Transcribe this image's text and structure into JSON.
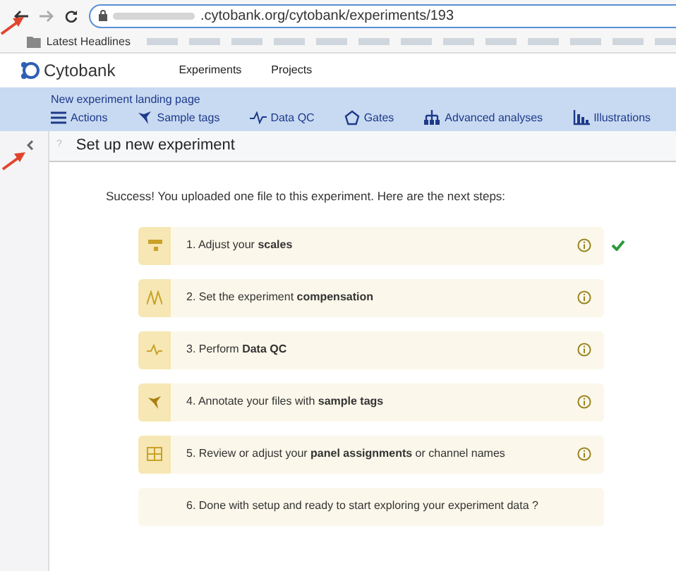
{
  "browser": {
    "url": ".cytobank.org/cytobank/experiments/193",
    "bookmarks_label": "Latest Headlines"
  },
  "header": {
    "brand": "Cytobank",
    "nav": [
      "Experiments",
      "Projects"
    ]
  },
  "toolbar": {
    "title": "New experiment landing page",
    "items": [
      {
        "label": "Actions",
        "kind": "menu"
      },
      {
        "label": "Sample tags",
        "kind": "tags"
      },
      {
        "label": "Data QC",
        "kind": "qc"
      },
      {
        "label": "Gates",
        "kind": "gates"
      },
      {
        "label": "Advanced analyses",
        "kind": "analyses"
      },
      {
        "label": "Illustrations",
        "kind": "illustrations"
      }
    ]
  },
  "panel": {
    "title": "Set up new experiment",
    "help": "?"
  },
  "intro": "Success! You uploaded one file to this experiment. Here are the next steps:",
  "steps": [
    {
      "text": "1. Adjust your **scales**",
      "kind": "scales",
      "done": true
    },
    {
      "text": "2. Set the experiment **compensation**",
      "kind": "compensation",
      "done": false
    },
    {
      "text": "3. Perform **Data QC**",
      "kind": "qc",
      "done": false
    },
    {
      "text": "4. Annotate your files with **sample tags**",
      "kind": "tags",
      "done": false
    },
    {
      "text": "5. Review or adjust your **panel assignments** or channel names",
      "kind": "panel",
      "done": false
    },
    {
      "text": "6. Done with setup and ready to start exploring your experiment data ?",
      "kind": "final",
      "done": false
    }
  ]
}
